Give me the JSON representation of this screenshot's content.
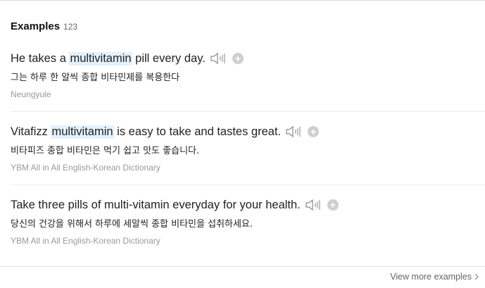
{
  "header": {
    "title": "Examples",
    "count": "123"
  },
  "examples": [
    {
      "before": "He takes a ",
      "highlight": "multivitamin",
      "after": " pill every day.",
      "translation": "그는 하루 한 알씩 종합 비타민제를 복용한다",
      "source": "Neungyule"
    },
    {
      "before": "Vitafizz ",
      "highlight": "multivitamin",
      "after": " is easy to take and tastes great.",
      "translation": "비타피즈 종합 비타민은 먹기 쉽고 맛도 좋습니다.",
      "source": "YBM All in All English-Korean Dictionary"
    },
    {
      "before": "Take three pills of multi-vitamin everyday for your health.",
      "highlight": "",
      "after": "",
      "translation": "당신의 건강을 위해서 하루에 세알씩 종합 비타민을 섭취하세요.",
      "source": "YBM All in All English-Korean Dictionary"
    }
  ],
  "footer": {
    "more_label": "View more examples"
  },
  "icons": {
    "speaker": "speaker-icon",
    "add": "add-icon",
    "chevron": "chevron-right-icon"
  },
  "colors": {
    "highlight": "#e3f1fd",
    "add_button": "#cfcfcf",
    "source_text": "#9a9a9a"
  }
}
